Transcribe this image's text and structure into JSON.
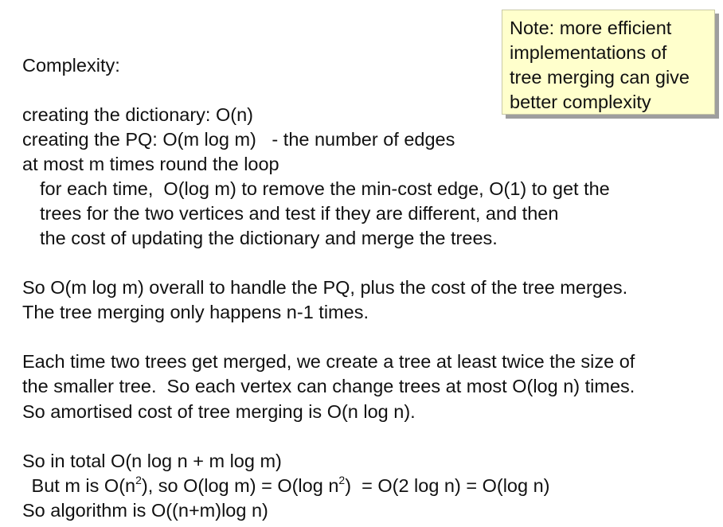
{
  "heading": "Complexity:",
  "lines": {
    "dict": "creating the dictionary: O(n)",
    "pq": "creating the PQ: O(m log m)   - the number of edges",
    "loop": "at most m times round the loop",
    "each1": "for each time,  O(log m) to remove the min-cost edge, O(1) to get the",
    "each2": "trees for the two vertices and test if they are different, and then",
    "each3": "the cost of updating the dictionary and merge the trees.",
    "so1": "So O(m log m) overall to handle the PQ, plus the cost of the tree merges.",
    "so2": "The tree merging only happens n-1 times.",
    "merge1": "Each time two trees get merged, we create a tree at least twice the size of",
    "merge2": "the smaller tree.  So each vertex can change trees at most O(log n) times.",
    "merge3": "So amortised cost of tree merging is O(n log n).",
    "total": "So in total O(n log n + m log m)",
    "but": {
      "p1": " But m is O(n",
      "sup1": "2",
      "p2": "), so O(log m) = O(log n",
      "sup2": "2",
      "p3": ")  = O(2 log n) = O(log n)"
    },
    "final": "So algorithm is O((n+m)log n)"
  },
  "note": {
    "lines": [
      "Note: more efficient",
      "implementations of",
      "tree merging can give",
      "better complexity"
    ],
    "background": "#ffffcc"
  }
}
